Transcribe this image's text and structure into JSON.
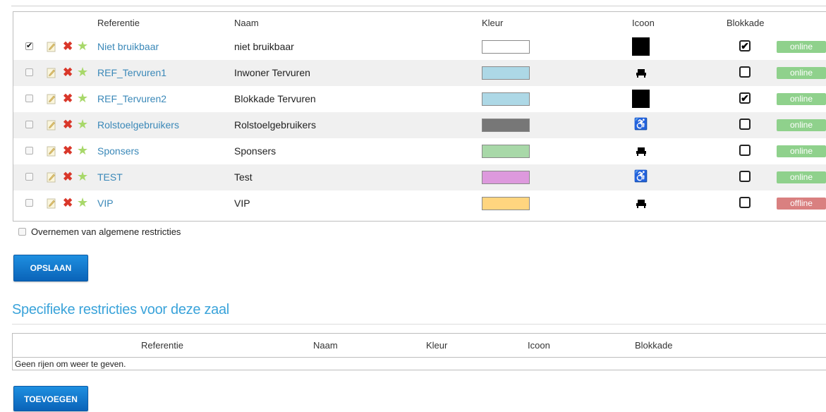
{
  "table": {
    "headers": {
      "referentie": "Referentie",
      "naam": "Naam",
      "kleur": "Kleur",
      "icoon": "Icoon",
      "blokkade": "Blokkade"
    },
    "rows": [
      {
        "selected": true,
        "referentie": "Niet bruikbaar",
        "naam": "niet bruikbaar",
        "kleur": "#ffffff",
        "icoon": "black-square-icon",
        "blokkade": true,
        "status": "online"
      },
      {
        "selected": false,
        "referentie": "REF_Tervuren1",
        "naam": "Inwoner Tervuren",
        "kleur": "#add8e6",
        "icoon": "seat-icon",
        "blokkade": false,
        "status": "online"
      },
      {
        "selected": false,
        "referentie": "REF_Tervuren2",
        "naam": "Blokkade Tervuren",
        "kleur": "#add8e6",
        "icoon": "black-square-icon",
        "blokkade": true,
        "status": "online"
      },
      {
        "selected": false,
        "referentie": "Rolstoelgebruikers",
        "naam": "Rolstoelgebruikers",
        "kleur": "#777777",
        "icoon": "wheelchair-icon",
        "blokkade": false,
        "status": "online"
      },
      {
        "selected": false,
        "referentie": "Sponsers",
        "naam": "Sponsers",
        "kleur": "#a8d8a8",
        "icoon": "seat-icon",
        "blokkade": false,
        "status": "online"
      },
      {
        "selected": false,
        "referentie": "TEST",
        "naam": "Test",
        "kleur": "#dd99dd",
        "icoon": "wheelchair-icon",
        "blokkade": false,
        "status": "online"
      },
      {
        "selected": false,
        "referentie": "VIP",
        "naam": "VIP",
        "kleur": "#ffd57f",
        "icoon": "seat-icon",
        "blokkade": false,
        "status": "offline"
      }
    ]
  },
  "overnemen_label": "Overnemen van algemene restricties",
  "save_button": "OPSLAAN",
  "specific": {
    "title": "Specifieke restricties voor deze zaal",
    "headers": {
      "referentie": "Referentie",
      "naam": "Naam",
      "kleur": "Kleur",
      "icoon": "Icoon",
      "blokkade": "Blokkade"
    },
    "empty_message": "Geen rijen om weer te geven.",
    "add_button": "TOEVOEGEN"
  },
  "colors": {
    "link": "#3a88b8",
    "title": "#3aa3da",
    "online": "#8fd18c",
    "offline": "#d98080",
    "button": "#0a63b8"
  }
}
